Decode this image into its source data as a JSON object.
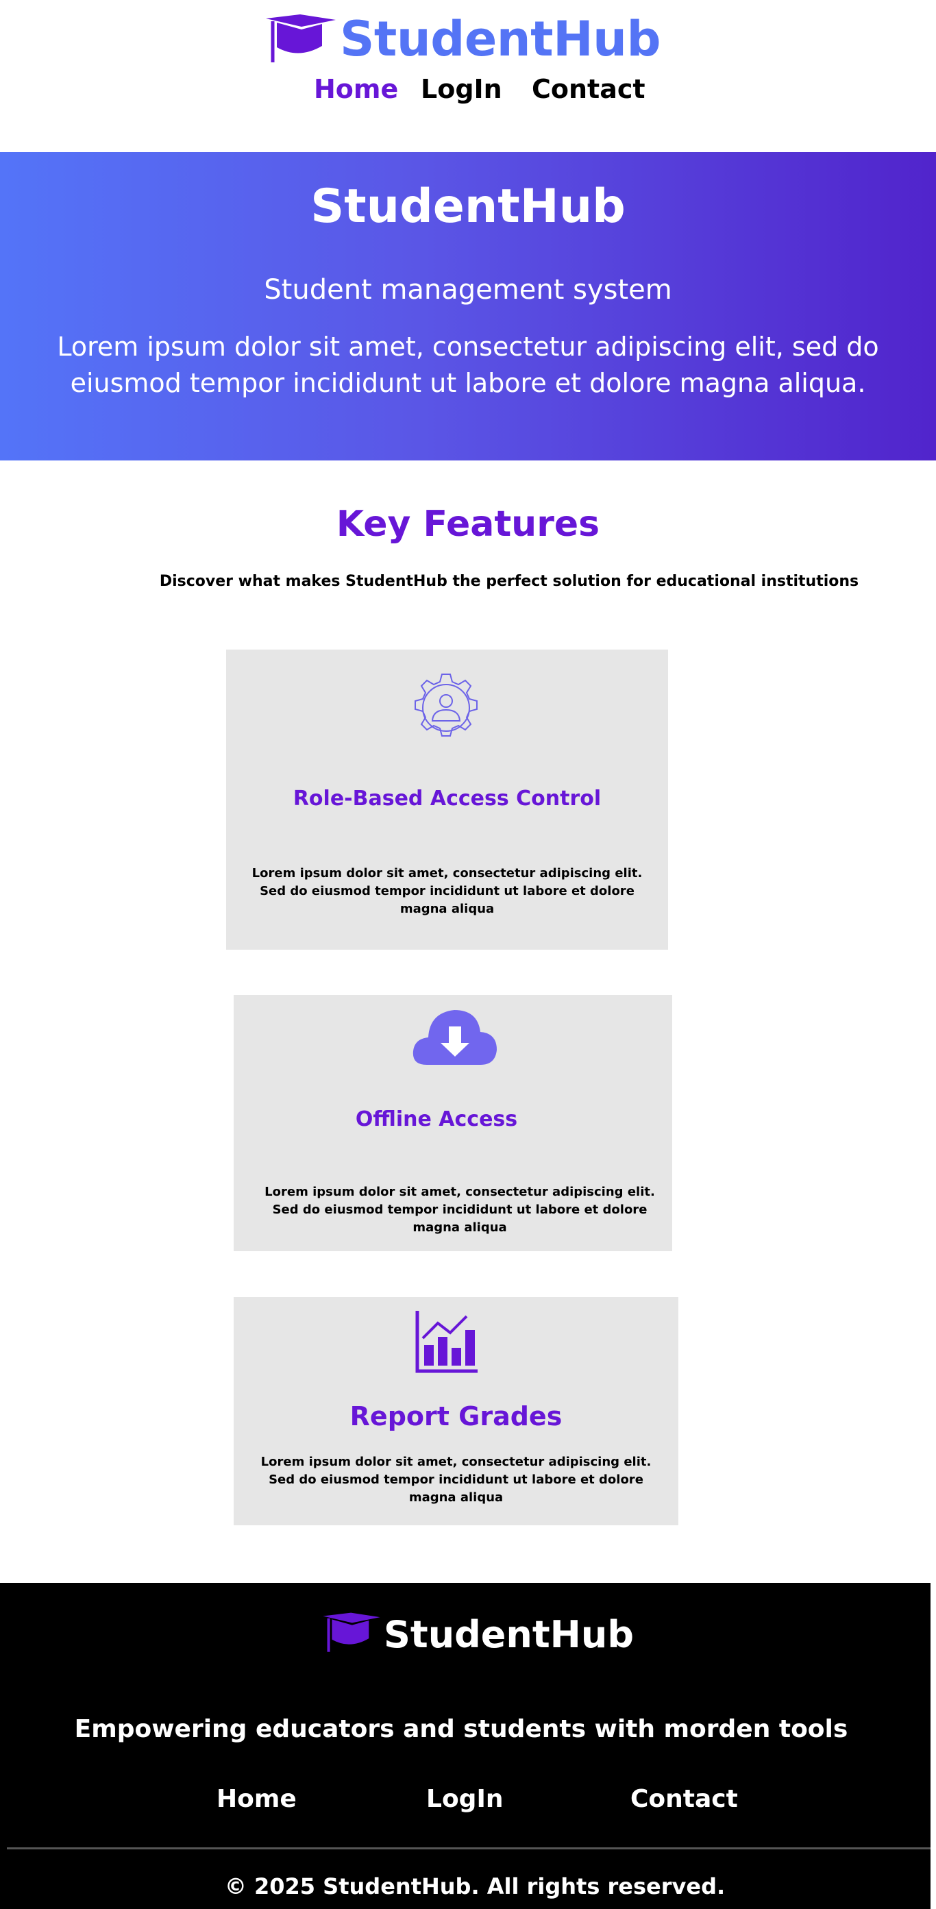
{
  "header": {
    "brand": "StudentHub",
    "nav": [
      {
        "label": "Home"
      },
      {
        "label": "LogIn"
      },
      {
        "label": "Contact"
      }
    ]
  },
  "hero": {
    "title": "StudentHub",
    "subtitle": "Student management system",
    "description": "Lorem ipsum dolor sit amet, consectetur adipiscing elit, sed do eiusmod tempor incididunt ut labore et dolore magna aliqua."
  },
  "features": {
    "title": "Key Features",
    "subtitle": "Discover what makes StudentHub the perfect solution for educational institutions",
    "cards": [
      {
        "icon": "gear-user-icon",
        "title": "Role-Based Access Control",
        "description": "Lorem ipsum dolor sit amet, consectetur adipiscing elit. Sed do eiusmod tempor incididunt ut labore et dolore magna aliqua"
      },
      {
        "icon": "cloud-download-icon",
        "title": "Offline Access",
        "description": "Lorem ipsum dolor sit amet, consectetur adipiscing elit. Sed do eiusmod tempor incididunt ut labore et dolore magna aliqua"
      },
      {
        "icon": "bar-chart-icon",
        "title": "Report Grades",
        "description": "Lorem ipsum dolor sit amet, consectetur adipiscing elit. Sed do eiusmod tempor incididunt ut labore et dolore magna aliqua"
      }
    ]
  },
  "footer": {
    "brand": "StudentHub",
    "tagline": "Empowering  educators and students with morden tools",
    "links": [
      {
        "label": "Home"
      },
      {
        "label": "LogIn"
      },
      {
        "label": "Contact"
      }
    ],
    "copyright": "© 2025 StudentHub. All rights reserved."
  },
  "colors": {
    "brand_blue": "#5474f5",
    "accent_purple": "#6716d7",
    "hero_gradient_start": "#5474f8",
    "hero_gradient_end": "#5124cc",
    "card_background": "#e6e6e6",
    "footer_background": "#000000"
  }
}
